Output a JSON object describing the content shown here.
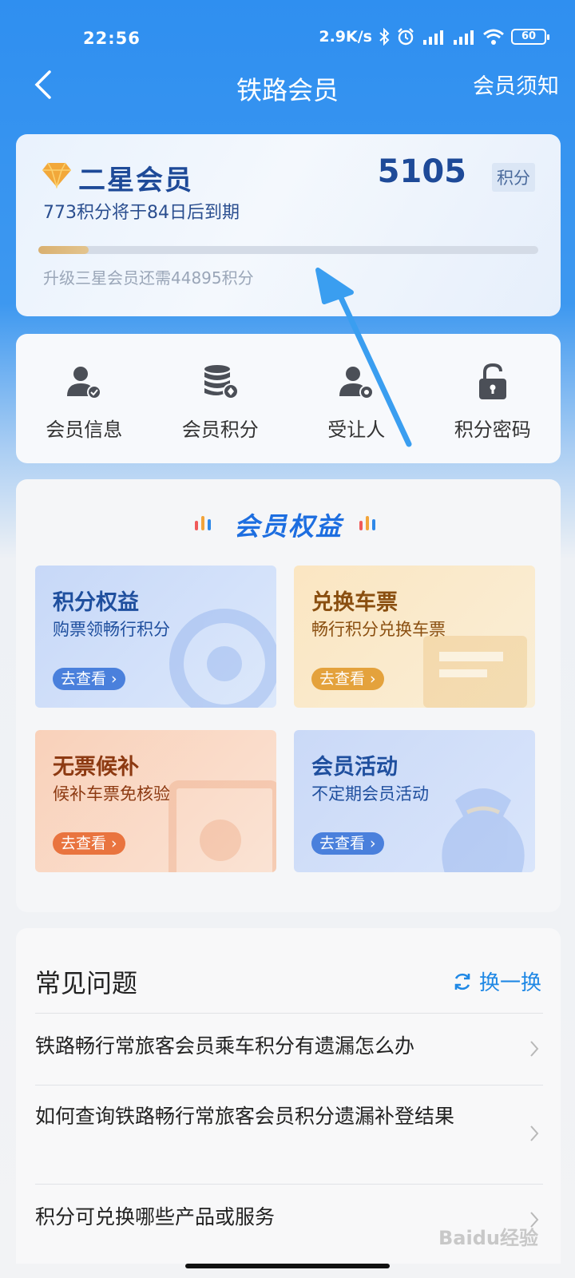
{
  "status_bar": {
    "time": "22:56",
    "speed": "2.9K/s",
    "battery": "60"
  },
  "nav": {
    "title": "铁路会员",
    "right_link": "会员须知"
  },
  "member_card": {
    "level": "二星会员",
    "points": "5105",
    "points_unit": "积分",
    "expire_notice": "773积分将于84日后到期",
    "upgrade_notice": "升级三星会员还需44895积分",
    "progress_fraction": 0.1
  },
  "quick_menu": [
    {
      "label": "会员信息",
      "icon": "member-info-icon"
    },
    {
      "label": "会员积分",
      "icon": "points-database-icon"
    },
    {
      "label": "受让人",
      "icon": "assignee-icon"
    },
    {
      "label": "积分密码",
      "icon": "lock-icon"
    }
  ],
  "benefits": {
    "title": "会员权益",
    "cards": [
      {
        "title": "积分权益",
        "subtitle": "购票领畅行积分",
        "button": "去查看"
      },
      {
        "title": "兑换车票",
        "subtitle": "畅行积分兑换车票",
        "button": "去查看"
      },
      {
        "title": "无票候补",
        "subtitle": "候补车票免核验",
        "button": "去查看"
      },
      {
        "title": "会员活动",
        "subtitle": "不定期会员活动",
        "button": "去查看"
      }
    ]
  },
  "faq": {
    "title": "常见问题",
    "refresh_label": "换一换",
    "items": [
      "铁路畅行常旅客会员乘车积分有遗漏怎么办",
      "如何查询铁路畅行常旅客会员积分遗漏补登结果",
      "积分可兑换哪些产品或服务"
    ]
  },
  "watermark": "Baidu经验"
}
